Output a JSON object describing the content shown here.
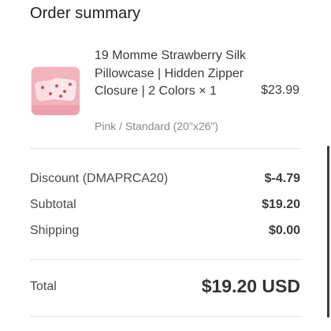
{
  "summary": {
    "title": "Order summary"
  },
  "item": {
    "name": "19 Momme Strawberry Silk Pillowcase | Hidden Zipper Closure | 2 Colors × 1",
    "variant": "Pink / Standard (20\"x26\")",
    "price": "$23.99",
    "image_icon": "pillowcase-product-thumbnail"
  },
  "lines": {
    "discount_label": "Discount (DMAPRCA20)",
    "discount_value": "$-4.79",
    "subtotal_label": "Subtotal",
    "subtotal_value": "$19.20",
    "shipping_label": "Shipping",
    "shipping_value": "$0.00"
  },
  "total": {
    "label": "Total",
    "value": "$19.20 USD"
  },
  "colors": {
    "thumbnail_bg": "#f3b6c0",
    "pillow": "#fbdde2",
    "divider": "#e2e2e2"
  }
}
